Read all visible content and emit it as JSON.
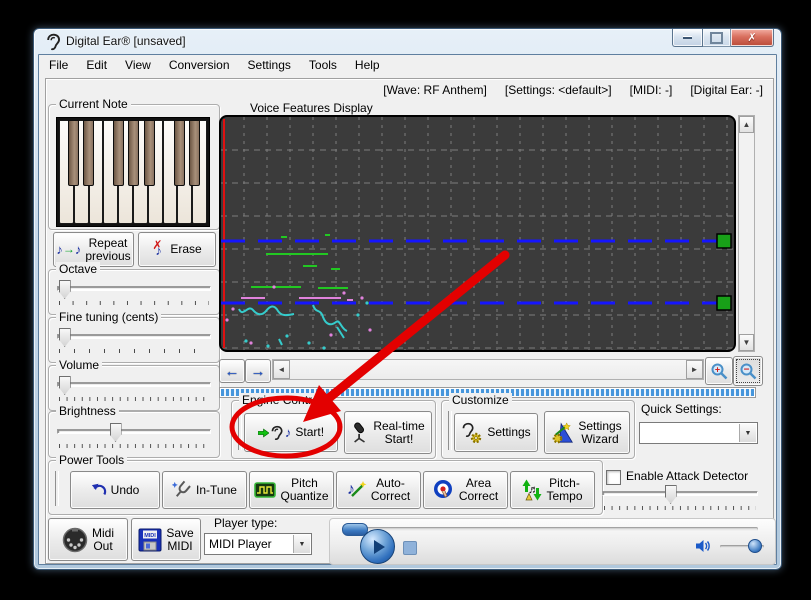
{
  "window": {
    "title": "Digital Ear® [unsaved]",
    "close_glyph": "✗"
  },
  "menu": {
    "items": [
      "File",
      "Edit",
      "View",
      "Conversion",
      "Settings",
      "Tools",
      "Help"
    ]
  },
  "status": {
    "wave": "[Wave: RF Anthem]",
    "settings": "[Settings: <default>]",
    "midi": "[MIDI: -]",
    "digital_ear": "[Digital Ear: -]"
  },
  "left": {
    "current_note_label": "Current Note",
    "repeat_line1": "Repeat",
    "repeat_line2": "previous",
    "erase_label": "Erase",
    "sliders": [
      {
        "label": "Octave",
        "value_pct": 5
      },
      {
        "label": "Fine tuning (cents)",
        "value_pct": 5
      },
      {
        "label": "Volume",
        "value_pct": 5
      },
      {
        "label": "Brightness",
        "value_pct": 38
      }
    ]
  },
  "display": {
    "label": "Voice Features Display"
  },
  "engine": {
    "label": "Engine Control",
    "start_label": "Start!",
    "realtime_line1": "Real-time",
    "realtime_line2": "Start!"
  },
  "customize": {
    "label": "Customize",
    "settings_label": "Settings",
    "wizard_line1": "Settings",
    "wizard_line2": "Wizard"
  },
  "quick_settings": {
    "label": "Quick Settings:",
    "value": ""
  },
  "power_tools": {
    "label": "Power Tools",
    "undo": "Undo",
    "intune": "In-Tune",
    "pq1": "Pitch",
    "pq2": "Quantize",
    "ac1": "Auto-",
    "ac2": "Correct",
    "ar1": "Area",
    "ar2": "Correct",
    "pt1": "Pitch-",
    "pt2": "Tempo"
  },
  "attack": {
    "label": "Enable Attack Detector",
    "checked": false,
    "value_pct": 44
  },
  "bottom": {
    "midi1": "Midi",
    "midi2": "Out",
    "save1": "Save",
    "save2": "MIDI",
    "player_label": "Player type:",
    "player_value": "MIDI Player"
  },
  "glyphs": {
    "note": "♪",
    "note2": "♬",
    "arrow_right": "→",
    "arrow_left": "←",
    "tri_up": "▲",
    "tri_down": "▼",
    "tri_left": "◄",
    "tri_right": "►",
    "cross": "✗",
    "dropdown": "▼"
  },
  "colors": {
    "annotation_red": "#e30000",
    "display_bg": "#3b3b3b",
    "grid_gray": "#8a8a8a",
    "pitch_line_blue": "#1515ff",
    "trace_cyan": "#35cccc",
    "trace_green": "#22c822",
    "trace_pink": "#e082dc",
    "handle_green": "#18a018",
    "stripe_blue": "#4696dc"
  }
}
